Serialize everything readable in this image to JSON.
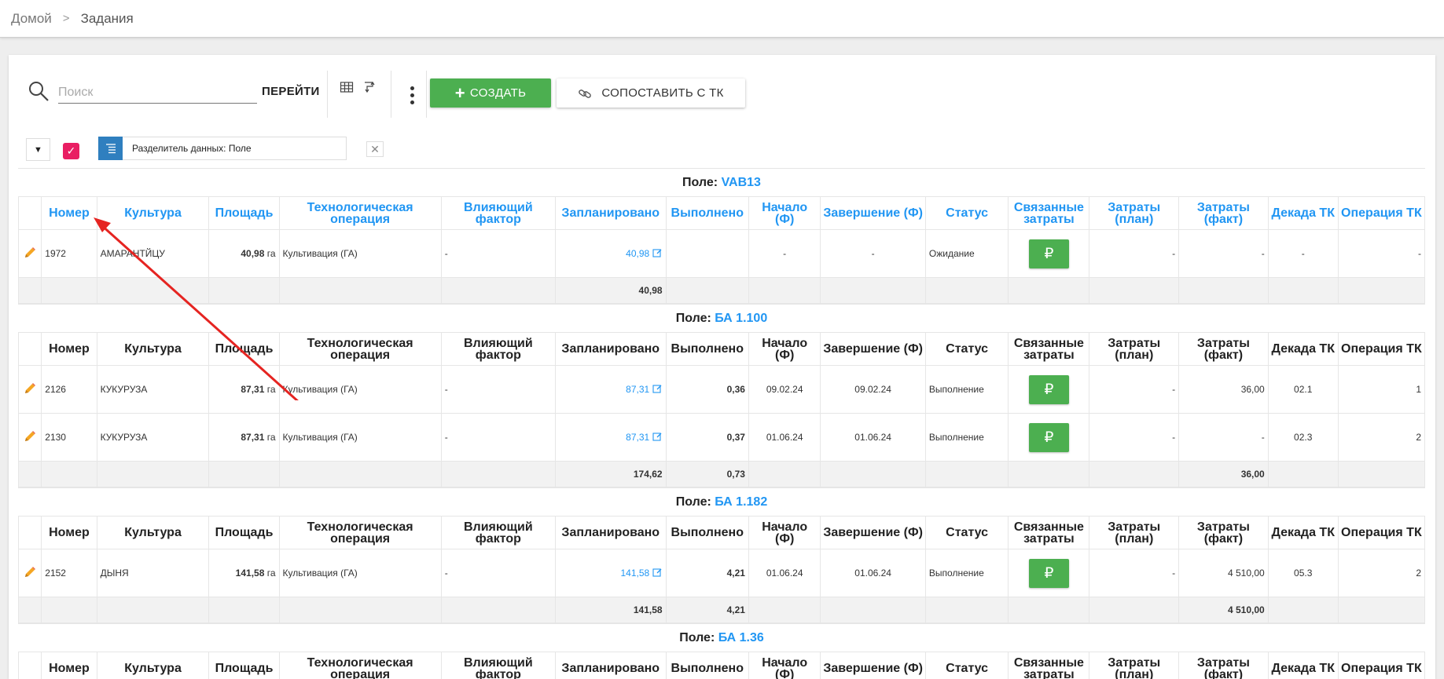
{
  "breadcrumb": {
    "home": "Домой",
    "separator": ">",
    "current": "Задания"
  },
  "toolbar": {
    "search_placeholder": "Поиск",
    "go_label": "ПЕРЕЙТИ",
    "create_label": "СОЗДАТЬ",
    "match_label": "СОПОСТАВИТЬ С ТК"
  },
  "filter": {
    "chip_label": "Разделитель данных: Поле",
    "close_symbol": "✕",
    "dropdown_symbol": "▼",
    "check_symbol": "✓"
  },
  "columns": [
    "Номер",
    "Культура",
    "Площадь",
    "Технологическая операция",
    "Влияющий фактор",
    "Запланировано",
    "Выполнено",
    "Начало (Ф)",
    "Завершение (Ф)",
    "Статус",
    "Связанные затраты",
    "Затраты (план)",
    "Затраты (факт)",
    "Декада ТК",
    "Операция ТК"
  ],
  "ruble_symbol": "₽",
  "area_unit": "га",
  "groups": [
    {
      "label": "Поле:",
      "field": "VAB13",
      "rows": [
        {
          "number": "1972",
          "crop": "АМАРАНТЙЦУ",
          "area": "40,98",
          "operation": "Культивация (ГА)",
          "factor": "-",
          "planned": "40,98",
          "done": "",
          "start": "-",
          "end": "-",
          "status": "Ожидание",
          "cost_plan": "-",
          "cost_fact": "-",
          "decade": "-",
          "op_tk": "-"
        }
      ],
      "total": {
        "planned": "40,98",
        "done": "",
        "cost_fact": ""
      }
    },
    {
      "label": "Поле:",
      "field": "БА 1.100",
      "rows": [
        {
          "number": "2126",
          "crop": "КУКУРУЗА",
          "area": "87,31",
          "operation": "Культивация (ГА)",
          "factor": "-",
          "planned": "87,31",
          "done": "0,36",
          "start": "09.02.24",
          "end": "09.02.24",
          "status": "Выполнение",
          "cost_plan": "-",
          "cost_fact": "36,00",
          "decade": "02.1",
          "op_tk": "1"
        },
        {
          "number": "2130",
          "crop": "КУКУРУЗА",
          "area": "87,31",
          "operation": "Культивация (ГА)",
          "factor": "-",
          "planned": "87,31",
          "done": "0,37",
          "start": "01.06.24",
          "end": "01.06.24",
          "status": "Выполнение",
          "cost_plan": "-",
          "cost_fact": "-",
          "decade": "02.3",
          "op_tk": "2"
        }
      ],
      "total": {
        "planned": "174,62",
        "done": "0,73",
        "cost_fact": "36,00"
      }
    },
    {
      "label": "Поле:",
      "field": "БА 1.182",
      "rows": [
        {
          "number": "2152",
          "crop": "ДЫНЯ",
          "area": "141,58",
          "operation": "Культивация (ГА)",
          "factor": "-",
          "planned": "141,58",
          "done": "4,21",
          "start": "01.06.24",
          "end": "01.06.24",
          "status": "Выполнение",
          "cost_plan": "-",
          "cost_fact": "4 510,00",
          "decade": "05.3",
          "op_tk": "2"
        }
      ],
      "total": {
        "planned": "141,58",
        "done": "4,21",
        "cost_fact": "4 510,00"
      }
    },
    {
      "label": "Поле:",
      "field": "БА 1.36",
      "rows": [],
      "total": null
    }
  ],
  "colors": {
    "accent": "#2196f3",
    "create_button": "#4caf50",
    "checkbox": "#e91e63",
    "chip_icon": "#2f7fbf",
    "annotation_arrow": "#e52421"
  }
}
